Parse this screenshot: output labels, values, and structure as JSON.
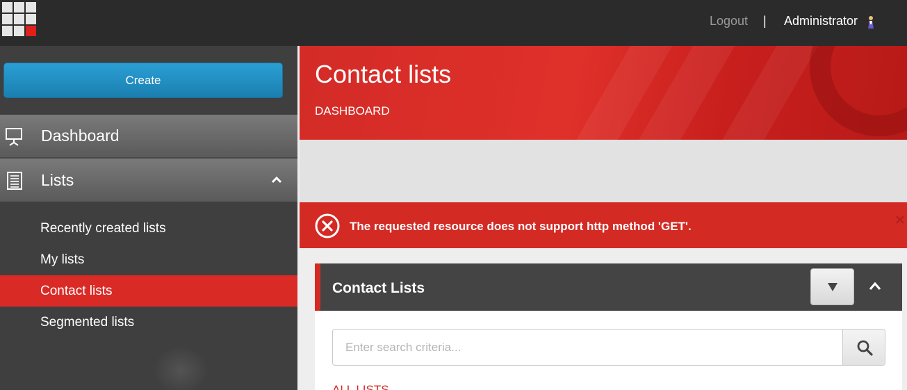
{
  "header": {
    "logout_label": "Logout",
    "separator": "|",
    "user_name": "Administrator"
  },
  "sidebar": {
    "create_label": "Create",
    "items": [
      {
        "label": "Dashboard",
        "icon": "presentation-board-icon"
      },
      {
        "label": "Lists",
        "icon": "list-icon",
        "expanded": true
      }
    ],
    "subitems": [
      {
        "label": "Recently created lists",
        "active": false
      },
      {
        "label": "My lists",
        "active": false
      },
      {
        "label": "Contact lists",
        "active": true
      },
      {
        "label": "Segmented lists",
        "active": false
      }
    ]
  },
  "main": {
    "page_title": "Contact lists",
    "breadcrumb": "DASHBOARD",
    "error_message": "The requested resource does not support http method 'GET'.",
    "panel": {
      "title": "Contact Lists",
      "search_placeholder": "Enter search criteria...",
      "all_lists_label": "ALL LISTS"
    }
  },
  "colors": {
    "accent_red": "#d42a24",
    "create_blue": "#2a9fd4",
    "topbar": "#2b2b2b",
    "sidebar": "#3f3f3f"
  }
}
